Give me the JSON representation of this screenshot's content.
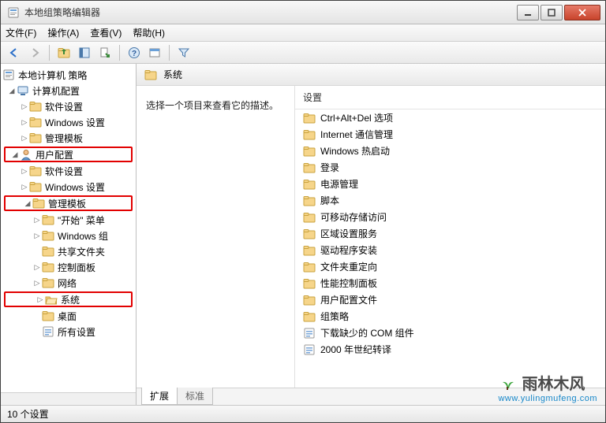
{
  "window": {
    "title": "本地组策略编辑器"
  },
  "menubar": [
    "文件(F)",
    "操作(A)",
    "查看(V)",
    "帮助(H)"
  ],
  "tree": {
    "root": "本地计算机 策略",
    "computer": {
      "label": "计算机配置",
      "children": [
        "软件设置",
        "Windows 设置",
        "管理模板"
      ]
    },
    "user": {
      "label": "用户配置",
      "children_top": [
        "软件设置",
        "Windows 设置"
      ],
      "admin_templates": "管理模板",
      "admin_children": [
        "\"开始\" 菜单",
        "Windows 组",
        "共享文件夹",
        "控制面板",
        "网络",
        "系统",
        "桌面"
      ],
      "all_settings": "所有设置"
    }
  },
  "detail": {
    "header": "系统",
    "prompt": "选择一个项目来查看它的描述。",
    "column": "设置",
    "items": [
      {
        "icon": "folder",
        "label": "Ctrl+Alt+Del 选项"
      },
      {
        "icon": "folder",
        "label": "Internet 通信管理"
      },
      {
        "icon": "folder",
        "label": "Windows 热启动"
      },
      {
        "icon": "folder",
        "label": "登录"
      },
      {
        "icon": "folder",
        "label": "电源管理"
      },
      {
        "icon": "folder",
        "label": "脚本"
      },
      {
        "icon": "folder",
        "label": "可移动存储访问"
      },
      {
        "icon": "folder",
        "label": "区域设置服务"
      },
      {
        "icon": "folder",
        "label": "驱动程序安装"
      },
      {
        "icon": "folder",
        "label": "文件夹重定向"
      },
      {
        "icon": "folder",
        "label": "性能控制面板"
      },
      {
        "icon": "folder",
        "label": "用户配置文件"
      },
      {
        "icon": "folder",
        "label": "组策略"
      },
      {
        "icon": "setting",
        "label": "下载缺少的 COM 组件"
      },
      {
        "icon": "setting",
        "label": "2000 年世纪转译"
      }
    ]
  },
  "tabs": {
    "extended": "扩展",
    "standard": "标准"
  },
  "statusbar": "10 个设置",
  "watermark": {
    "brand": "雨林木风",
    "url": "www.yulingmufeng.com"
  }
}
